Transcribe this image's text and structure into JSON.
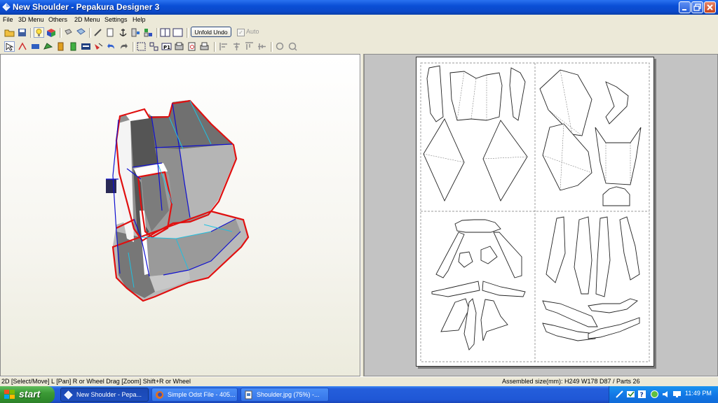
{
  "window": {
    "title": "New Shoulder - Pepakura Designer 3"
  },
  "menu": [
    "File",
    "3D Menu",
    "Others",
    "2D Menu",
    "Settings",
    "Help"
  ],
  "toolbar": {
    "unfold_undo_label": "Unfold Undo",
    "auto_label": "Auto",
    "auto_checked": true
  },
  "toolbar_icons_row1": [
    "open-file-icon",
    "save-icon",
    "light-bulb-icon",
    "texture-cube-icon",
    "rotate-icon",
    "view-cube-icon",
    "cut-edge-icon",
    "copy-icon",
    "anchor-icon",
    "tile-icon",
    "window-split-icon",
    "window-single-icon"
  ],
  "toolbar_icons_row2": [
    "select-move-icon",
    "join-edge-icon",
    "move-face-icon",
    "edit-flap-icon",
    "rotate-part-icon",
    "battery-icon",
    "card-icon",
    "flip-icon",
    "undo-arrow-icon",
    "return-icon",
    "fit-icon",
    "tile-parts-icon",
    "print-label-icon",
    "page-setup-icon",
    "print-preview-icon",
    "print-icon",
    "align-left-icon",
    "align-center-icon",
    "align-top-icon",
    "align-middle-icon",
    "zoom-in-icon",
    "zoom-out-icon"
  ],
  "status": {
    "left": "2D [Select/Move] L [Pan] R or Wheel Drag [Zoom] Shift+R or Wheel",
    "right": "Assembled size(mm): H249 W178 D87 / Parts 26"
  },
  "taskbar": {
    "start_label": "start",
    "tasks": [
      "New Shoulder - Pepa...",
      "Simple Odst File - 405...",
      "Shoulder.jpg (75%) -..."
    ],
    "active_task": 0,
    "clock": "11:49 PM"
  },
  "tray_icons": [
    "network-icon",
    "shield-icon",
    "help-icon",
    "speaker-icon",
    "messenger-icon",
    "monitor-icon"
  ],
  "colors": {
    "titlebar": "#0a4fd6",
    "cut_line": "#e01010",
    "mountain_fold": "#1010d0",
    "valley_fold": "#20c0e0",
    "start_button": "#3c9a36"
  }
}
